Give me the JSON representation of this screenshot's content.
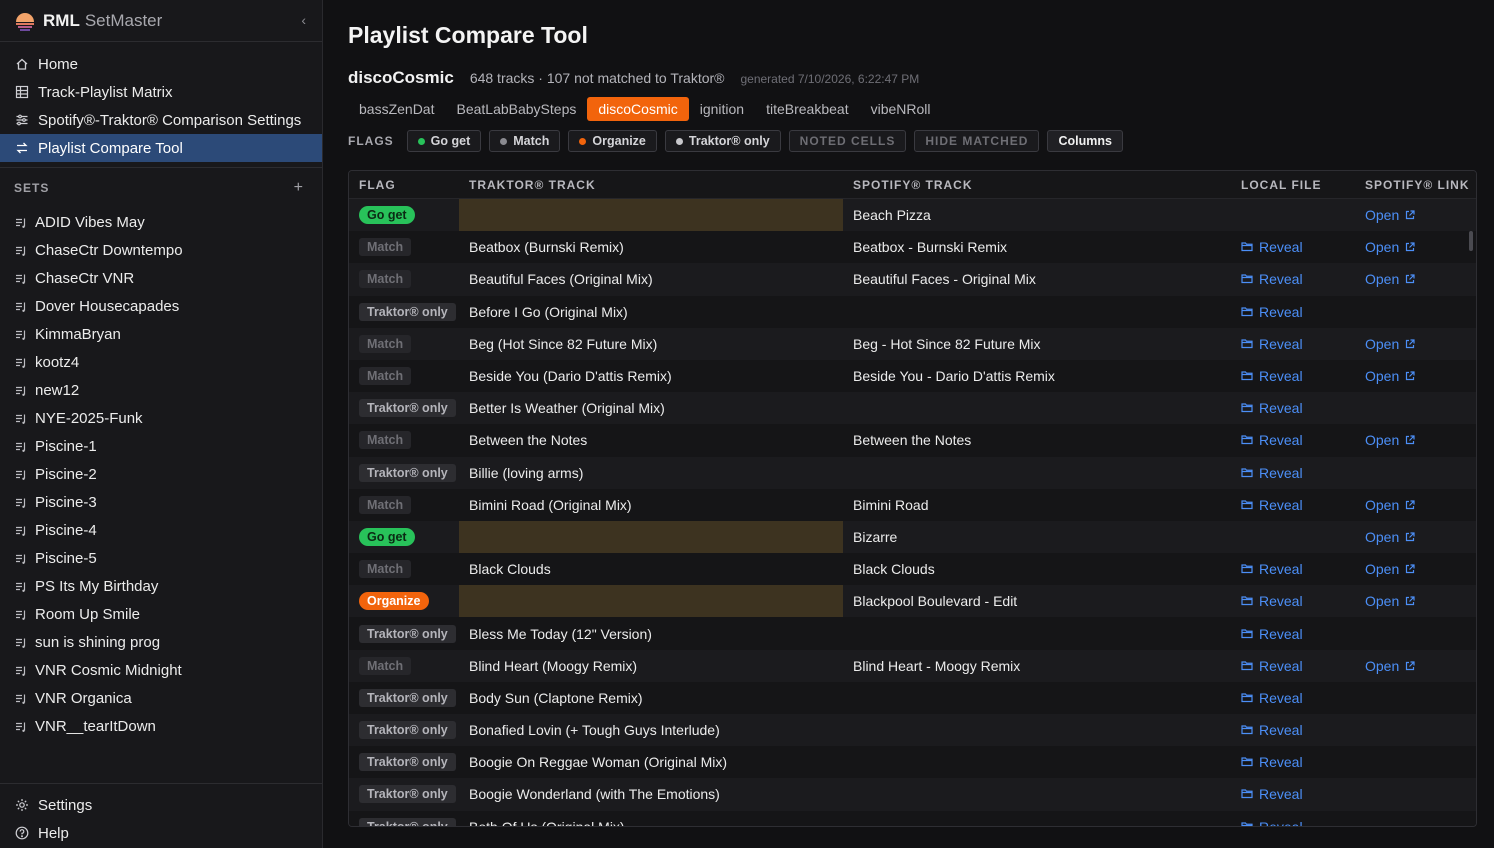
{
  "brand": {
    "name": "RML",
    "sub": "SetMaster"
  },
  "nav": [
    {
      "label": "Home",
      "icon": "home-icon"
    },
    {
      "label": "Track-Playlist Matrix",
      "icon": "grid-icon"
    },
    {
      "label": "Spotify®-Traktor® Comparison Settings",
      "icon": "sliders-icon"
    },
    {
      "label": "Playlist Compare Tool",
      "icon": "compare-icon",
      "active": true
    }
  ],
  "sets_header": "SETS",
  "sets": [
    "ADID Vibes May",
    "ChaseCtr Downtempo",
    "ChaseCtr VNR",
    "Dover Housecapades",
    "KimmaBryan",
    "kootz4",
    "new12",
    "NYE-2025-Funk",
    "Piscine-1",
    "Piscine-2",
    "Piscine-3",
    "Piscine-4",
    "Piscine-5",
    "PS Its My Birthday",
    "Room Up Smile",
    "sun is shining prog",
    "VNR Cosmic Midnight",
    "VNR Organica",
    "VNR__tearItDown"
  ],
  "bottom_nav": [
    {
      "label": "Settings",
      "icon": "gear-icon"
    },
    {
      "label": "Help",
      "icon": "help-icon"
    }
  ],
  "page": {
    "title": "Playlist Compare Tool",
    "playlist": "discoCosmic",
    "stats": "648 tracks · 107 not matched to Traktor®",
    "generated": "generated 7/10/2026, 6:22:47 PM"
  },
  "tabs": [
    {
      "label": "bassZenDat"
    },
    {
      "label": "BeatLabBabySteps"
    },
    {
      "label": "discoCosmic",
      "active": true
    },
    {
      "label": "ignition"
    },
    {
      "label": "titeBreakbeat"
    },
    {
      "label": "vibeNRoll"
    }
  ],
  "flags_label": "FLAGS",
  "flag_filters": [
    {
      "label": "Go get",
      "dot": "#28c25a"
    },
    {
      "label": "Match",
      "dot": "#8a8a90"
    },
    {
      "label": "Organize",
      "dot": "#f2640c"
    },
    {
      "label": "Traktor® only",
      "dot": "#c8c8cc"
    }
  ],
  "toggles": {
    "noted": "NOTED CELLS",
    "hide": "HIDE MATCHED",
    "columns": "Columns"
  },
  "columns": {
    "flag": "FLAG",
    "traktor": "TRAKTOR® TRACK",
    "spotify": "SPOTIFY® TRACK",
    "local": "LOCAL FILE",
    "link": "SPOTIFY® LINK"
  },
  "colors": {
    "go_get": "#28c25a",
    "organize": "#f2640c",
    "accent": "#2c4a78",
    "link": "#4c8ff7",
    "missing_cell": "#3d3320"
  },
  "rows": [
    {
      "flag": "Go get",
      "kind": "goget",
      "traktor": "",
      "spotify": "Beach Pizza",
      "local": "",
      "link": "Open"
    },
    {
      "flag": "Match",
      "kind": "match",
      "traktor": "Beatbox (Burnski Remix)",
      "spotify": "Beatbox - Burnski Remix",
      "local": "Reveal",
      "link": "Open"
    },
    {
      "flag": "Match",
      "kind": "match",
      "traktor": "Beautiful Faces (Original Mix)",
      "spotify": "Beautiful Faces - Original Mix",
      "local": "Reveal",
      "link": "Open"
    },
    {
      "flag": "Traktor® only",
      "kind": "tonly",
      "traktor": "Before I Go (Original Mix)",
      "spotify": "",
      "local": "Reveal",
      "link": ""
    },
    {
      "flag": "Match",
      "kind": "match",
      "traktor": "Beg (Hot Since 82 Future Mix)",
      "spotify": "Beg - Hot Since 82 Future Mix",
      "local": "Reveal",
      "link": "Open"
    },
    {
      "flag": "Match",
      "kind": "match",
      "traktor": "Beside You (Dario D'attis Remix)",
      "spotify": "Beside You - Dario D'attis Remix",
      "local": "Reveal",
      "link": "Open"
    },
    {
      "flag": "Traktor® only",
      "kind": "tonly",
      "traktor": "Better Is Weather (Original Mix)",
      "spotify": "",
      "local": "Reveal",
      "link": ""
    },
    {
      "flag": "Match",
      "kind": "match",
      "traktor": "Between the Notes",
      "spotify": "Between the Notes",
      "local": "Reveal",
      "link": "Open"
    },
    {
      "flag": "Traktor® only",
      "kind": "tonly",
      "traktor": "Billie (loving arms)",
      "spotify": "",
      "local": "Reveal",
      "link": ""
    },
    {
      "flag": "Match",
      "kind": "match",
      "traktor": "Bimini Road (Original Mix)",
      "spotify": "Bimini Road",
      "local": "Reveal",
      "link": "Open"
    },
    {
      "flag": "Go get",
      "kind": "goget",
      "traktor": "",
      "spotify": "Bizarre",
      "local": "",
      "link": "Open"
    },
    {
      "flag": "Match",
      "kind": "match",
      "traktor": "Black Clouds",
      "spotify": "Black Clouds",
      "local": "Reveal",
      "link": "Open"
    },
    {
      "flag": "Organize",
      "kind": "organize",
      "traktor": "",
      "spotify": "Blackpool Boulevard - Edit",
      "local": "Reveal",
      "link": "Open"
    },
    {
      "flag": "Traktor® only",
      "kind": "tonly",
      "traktor": "Bless Me Today (12\" Version)",
      "spotify": "",
      "local": "Reveal",
      "link": ""
    },
    {
      "flag": "Match",
      "kind": "match",
      "traktor": "Blind Heart (Moogy Remix)",
      "spotify": "Blind Heart - Moogy Remix",
      "local": "Reveal",
      "link": "Open"
    },
    {
      "flag": "Traktor® only",
      "kind": "tonly",
      "traktor": "Body Sun (Claptone Remix)",
      "spotify": "",
      "local": "Reveal",
      "link": ""
    },
    {
      "flag": "Traktor® only",
      "kind": "tonly",
      "traktor": "Bonafied Lovin (+ Tough Guys Interlude)",
      "spotify": "",
      "local": "Reveal",
      "link": ""
    },
    {
      "flag": "Traktor® only",
      "kind": "tonly",
      "traktor": "Boogie On Reggae Woman (Original Mix)",
      "spotify": "",
      "local": "Reveal",
      "link": ""
    },
    {
      "flag": "Traktor® only",
      "kind": "tonly",
      "traktor": "Boogie Wonderland (with The Emotions)",
      "spotify": "",
      "local": "Reveal",
      "link": ""
    },
    {
      "flag": "Traktor® only",
      "kind": "tonly",
      "traktor": "Both Of Us (Original Mix)",
      "spotify": "",
      "local": "Reveal",
      "link": ""
    }
  ]
}
